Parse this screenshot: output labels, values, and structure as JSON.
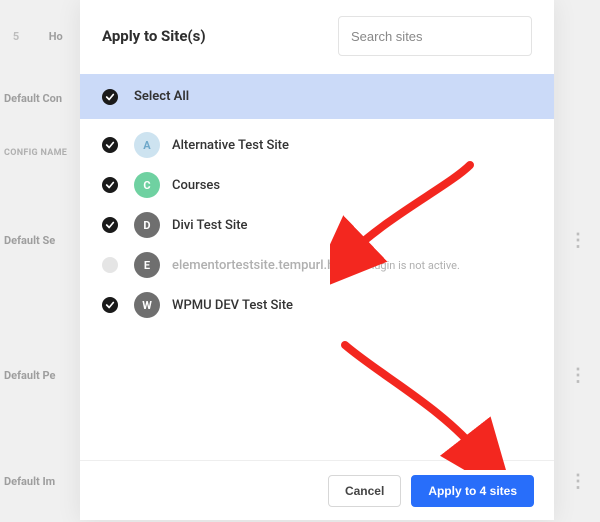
{
  "modal": {
    "title": "Apply to Site(s)",
    "search_placeholder": "Search sites",
    "select_all_label": "Select All",
    "inactive_note": "Plugin is not active.",
    "cancel_label": "Cancel",
    "apply_label": "Apply to 4 sites"
  },
  "sites": [
    {
      "letter": "A",
      "name": "Alternative Test Site",
      "avatar_color": "#cde3f0",
      "avatar_text": "#6ea8c9",
      "checked": true,
      "disabled": false
    },
    {
      "letter": "C",
      "name": "Courses",
      "avatar_color": "#6fd1a1",
      "avatar_text": "#ffffff",
      "checked": true,
      "disabled": false
    },
    {
      "letter": "D",
      "name": "Divi Test Site",
      "avatar_color": "#6f6f6f",
      "avatar_text": "#ffffff",
      "checked": true,
      "disabled": false
    },
    {
      "letter": "E",
      "name": "elementortestsite.tempurl.host",
      "avatar_color": "#6f6f6f",
      "avatar_text": "#ffffff",
      "checked": false,
      "disabled": true
    },
    {
      "letter": "W",
      "name": "WPMU DEV Test Site",
      "avatar_color": "#6f6f6f",
      "avatar_text": "#ffffff",
      "checked": true,
      "disabled": false
    }
  ],
  "background": {
    "r0_left": "5",
    "r0_text": "Ho",
    "r1": "Default Con",
    "r2": "CONFIG NAME",
    "r3": "Default Se",
    "r4": "Default Pe",
    "r5": "Default Im"
  }
}
